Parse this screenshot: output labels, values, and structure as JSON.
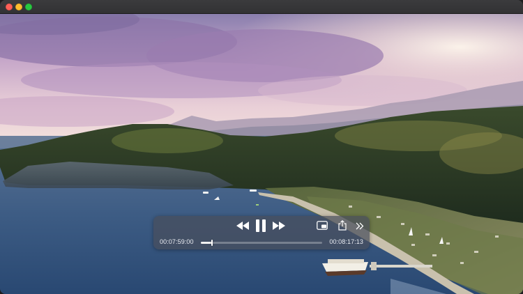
{
  "window": {
    "controls": [
      "close",
      "minimize",
      "zoom"
    ],
    "colors": {
      "close": "#fe5f57",
      "minimize": "#febc2e",
      "zoom": "#28c840"
    }
  },
  "player": {
    "video_scene": "aerial-coastline",
    "controls": {
      "rewind_icon": "rewind-icon",
      "play_pause_icon": "pause-icon",
      "fast_forward_icon": "fast-forward-icon",
      "pip_icon": "picture-in-picture-icon",
      "share_icon": "share-icon",
      "more_icon": "chevron-double-right-icon"
    },
    "time_elapsed": "00:07:59:00",
    "time_remaining": "00:08:17:13",
    "progress": 0.09
  }
}
